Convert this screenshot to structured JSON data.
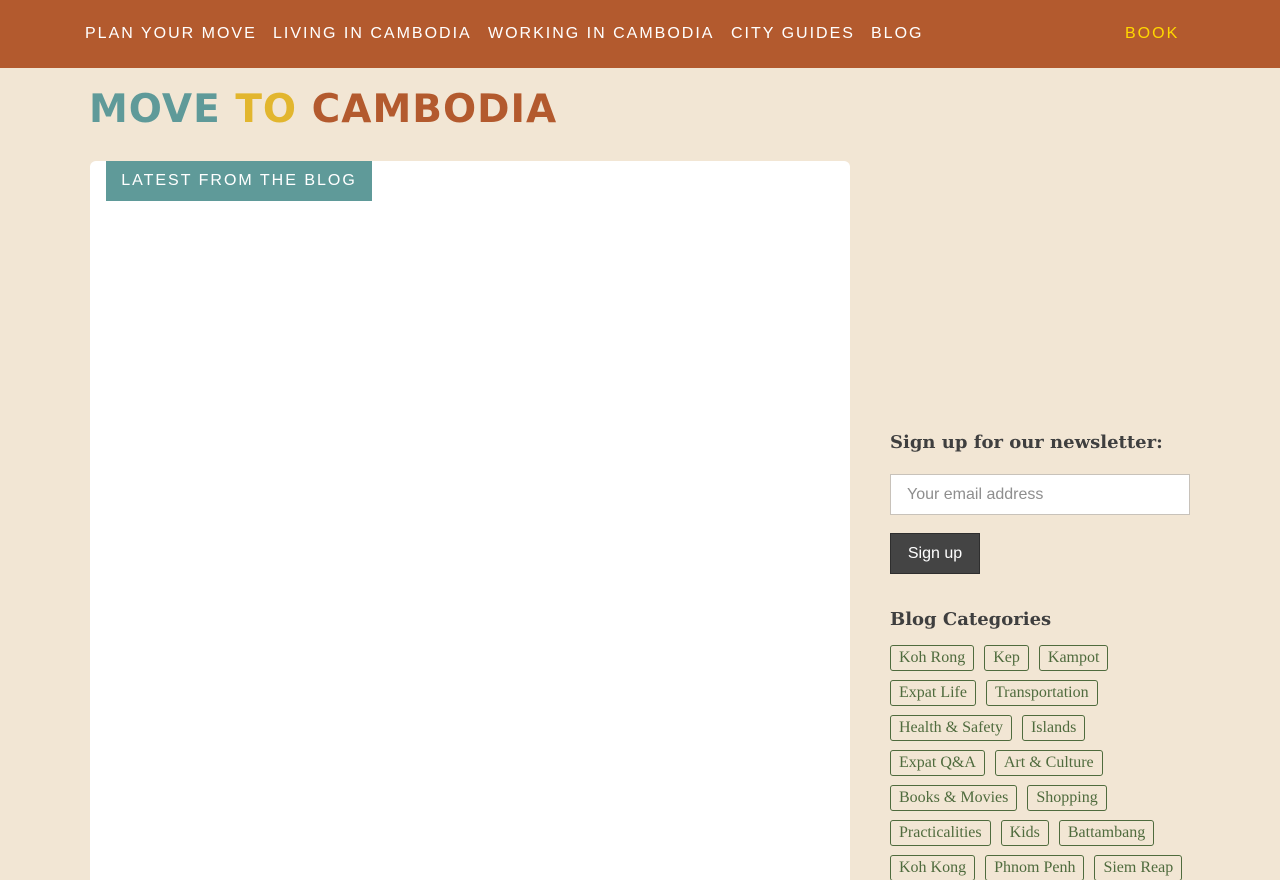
{
  "nav": {
    "items": [
      {
        "label": "PLAN YOUR MOVE"
      },
      {
        "label": "LIVING IN CAMBODIA"
      },
      {
        "label": "WORKING IN CAMBODIA"
      },
      {
        "label": "CITY GUIDES"
      },
      {
        "label": "BLOG"
      }
    ],
    "book": "BOOK"
  },
  "logo": {
    "word1": "MOVE",
    "word2": "TO",
    "word3": "CAMBODIA"
  },
  "main": {
    "tab_label": "LATEST FROM THE BLOG"
  },
  "sidebar": {
    "newsletter_title": "Sign up for our newsletter:",
    "email_placeholder": "Your email address",
    "signup_label": "Sign up",
    "categories_title": "Blog Categories",
    "categories": [
      [
        "Koh Rong",
        "Kep",
        "Kampot"
      ],
      [
        "Expat Life",
        "Transportation"
      ],
      [
        "Health & Safety",
        "Islands"
      ],
      [
        "Expat Q&A",
        "Art & Culture"
      ],
      [
        "Books & Movies",
        "Shopping"
      ],
      [
        "Practicalities",
        "Kids",
        "Battambang"
      ],
      [
        "Koh Kong",
        "Phnom Penh",
        "Siem Reap"
      ]
    ]
  },
  "colors": {
    "nav_bg": "#b35a2e",
    "page_bg": "#f2e6d4",
    "accent_teal": "#5f9a99",
    "accent_yellow": "#e2b62e",
    "tag_green": "#4f6b3d"
  }
}
